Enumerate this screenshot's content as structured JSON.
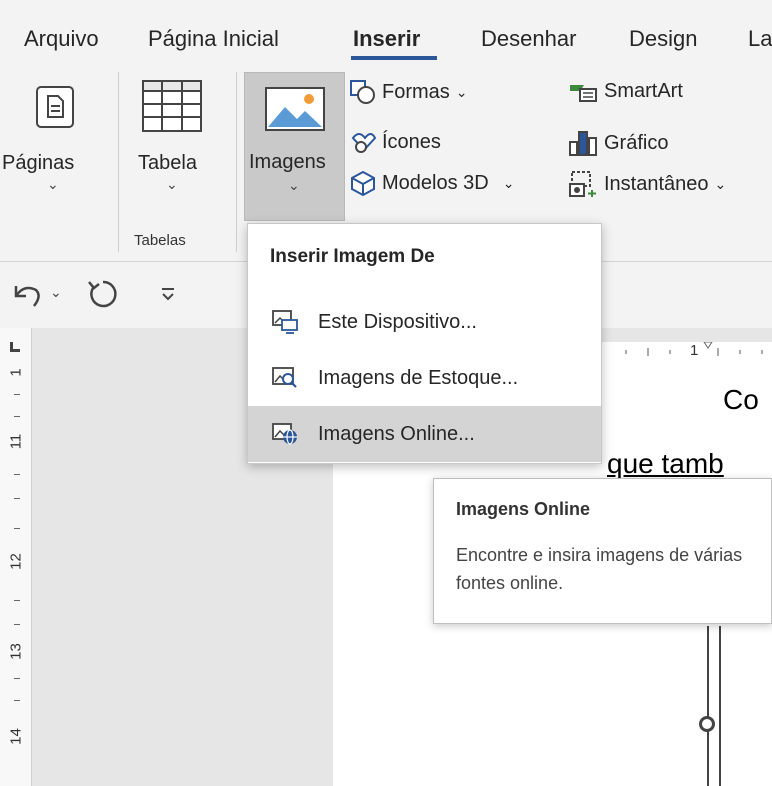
{
  "tabs": [
    {
      "label": "Arquivo",
      "active": false
    },
    {
      "label": "Página Inicial",
      "active": false
    },
    {
      "label": "Inserir",
      "active": true
    },
    {
      "label": "Desenhar",
      "active": false
    },
    {
      "label": "Design",
      "active": false
    },
    {
      "label": "La",
      "active": false
    }
  ],
  "ribbon": {
    "paginas": "Páginas",
    "tabela": "Tabela",
    "tabelas_group": "Tabelas",
    "imagens": "Imagens",
    "formas": "Formas",
    "icones": "Ícones",
    "modelos3d": "Modelos 3D",
    "smartart": "SmartArt",
    "grafico": "Gráfico",
    "instantaneo": "Instantâneo",
    "chevron": "⌄"
  },
  "dropdown": {
    "header": "Inserir Imagem De",
    "items": [
      {
        "label": "Este Dispositivo...",
        "icon": "device-image-icon"
      },
      {
        "label": "Imagens de Estoque...",
        "icon": "stock-image-icon"
      },
      {
        "label": "Imagens Online...",
        "icon": "online-image-icon",
        "hovered": true
      }
    ]
  },
  "tooltip": {
    "title": "Imagens Online",
    "description": "Encontre e insira imagens de várias fontes online."
  },
  "document": {
    "text_line1": "Co",
    "text_line2": "que tamb"
  },
  "ruler": {
    "vertical_numbers": [
      "1",
      "11",
      "12",
      "13",
      "14"
    ],
    "horizontal_number": "1"
  },
  "colors": {
    "accent": "#2b579a",
    "ribbon_bg": "#f3f3f3",
    "selected_button": "#c9c9c9",
    "menu_hover": "#d4d4d4"
  }
}
